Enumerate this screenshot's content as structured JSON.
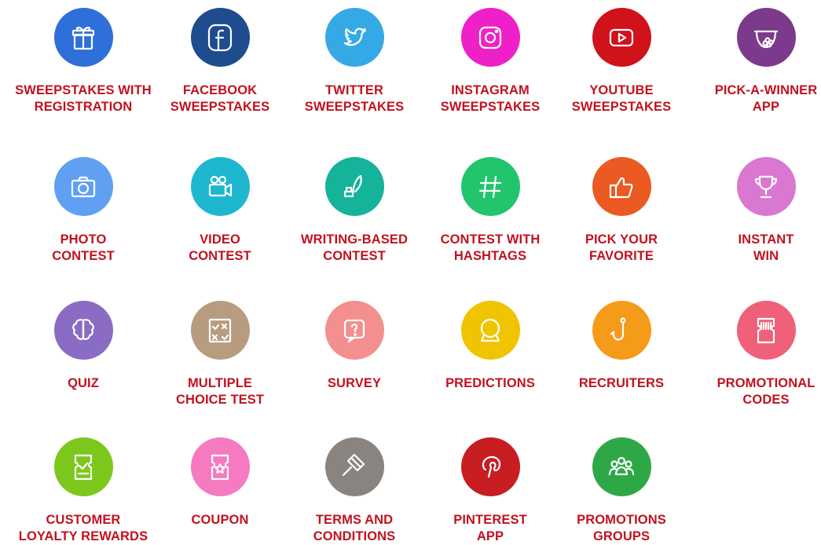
{
  "colors": {
    "label": "#c1121f"
  },
  "apps": [
    {
      "id": "sweepstakes-registration",
      "icon": "gift-icon",
      "color": "#2e6fd9",
      "lines": [
        "SWEEPSTAKES WITH",
        "REGISTRATION"
      ]
    },
    {
      "id": "facebook-sweepstakes",
      "icon": "facebook-icon",
      "color": "#1f4b8f",
      "lines": [
        "FACEBOOK",
        "SWEEPSTAKES"
      ]
    },
    {
      "id": "twitter-sweepstakes",
      "icon": "twitter-icon",
      "color": "#35a9e6",
      "lines": [
        "TWITTER",
        "SWEEPSTAKES"
      ]
    },
    {
      "id": "instagram-sweepstakes",
      "icon": "instagram-icon",
      "color": "#ee21c8",
      "lines": [
        "INSTAGRAM",
        "SWEEPSTAKES"
      ]
    },
    {
      "id": "youtube-sweepstakes",
      "icon": "youtube-icon",
      "color": "#d0121b",
      "lines": [
        "YOUTUBE",
        "SWEEPSTAKES"
      ]
    },
    {
      "id": "pick-a-winner",
      "icon": "prize-bowl-icon",
      "color": "#7b3a8c",
      "lines": [
        "PICK-A-WINNER",
        "APP"
      ]
    },
    {
      "id": "photo-contest",
      "icon": "camera-icon",
      "color": "#5fa0f2",
      "lines": [
        "PHOTO",
        "CONTEST"
      ]
    },
    {
      "id": "video-contest",
      "icon": "video-camera-icon",
      "color": "#1fb7cf",
      "lines": [
        "VIDEO",
        "CONTEST"
      ]
    },
    {
      "id": "writing-contest",
      "icon": "quill-ink-icon",
      "color": "#14b39a",
      "lines": [
        "WRITING-BASED",
        "CONTEST"
      ]
    },
    {
      "id": "hashtag-contest",
      "icon": "hashtag-icon",
      "color": "#22c46c",
      "lines": [
        "CONTEST WITH",
        "HASHTAGS"
      ]
    },
    {
      "id": "pick-your-favorite",
      "icon": "thumbs-up-icon",
      "color": "#ea5a22",
      "lines": [
        "PICK YOUR",
        "FAVORITE"
      ]
    },
    {
      "id": "instant-win",
      "icon": "trophy-icon",
      "color": "#d977d1",
      "lines": [
        "INSTANT",
        "WIN"
      ]
    },
    {
      "id": "quiz",
      "icon": "brain-icon",
      "color": "#8a6cc4",
      "lines": [
        "QUIZ"
      ]
    },
    {
      "id": "multiple-choice-test",
      "icon": "checklist-icon",
      "color": "#b79c80",
      "lines": [
        "MULTIPLE",
        "CHOICE TEST"
      ]
    },
    {
      "id": "survey",
      "icon": "question-bubble-icon",
      "color": "#f38f8f",
      "lines": [
        "SURVEY"
      ]
    },
    {
      "id": "predictions",
      "icon": "crystal-ball-icon",
      "color": "#f0c400",
      "lines": [
        "PREDICTIONS"
      ]
    },
    {
      "id": "recruiters",
      "icon": "hook-icon",
      "color": "#f59b1a",
      "lines": [
        "RECRUITERS"
      ]
    },
    {
      "id": "promotional-codes",
      "icon": "barcode-ticket-icon",
      "color": "#f0607a",
      "lines": [
        "PROMOTIONAL",
        "CODES"
      ]
    },
    {
      "id": "customer-loyalty",
      "icon": "check-ticket-icon",
      "color": "#7cc81c",
      "lines": [
        "CUSTOMER",
        "LOYALTY REWARDS"
      ]
    },
    {
      "id": "coupon",
      "icon": "star-ticket-icon",
      "color": "#f57ac0",
      "lines": [
        "COUPON"
      ]
    },
    {
      "id": "terms-conditions",
      "icon": "gavel-icon",
      "color": "#8a8480",
      "lines": [
        "TERMS AND",
        "CONDITIONS"
      ]
    },
    {
      "id": "pinterest-app",
      "icon": "pinterest-icon",
      "color": "#c81e22",
      "lines": [
        "PINTEREST",
        "APP"
      ]
    },
    {
      "id": "promotions-groups",
      "icon": "group-icon",
      "color": "#2ea847",
      "lines": [
        "PROMOTIONS",
        "GROUPS"
      ]
    }
  ]
}
